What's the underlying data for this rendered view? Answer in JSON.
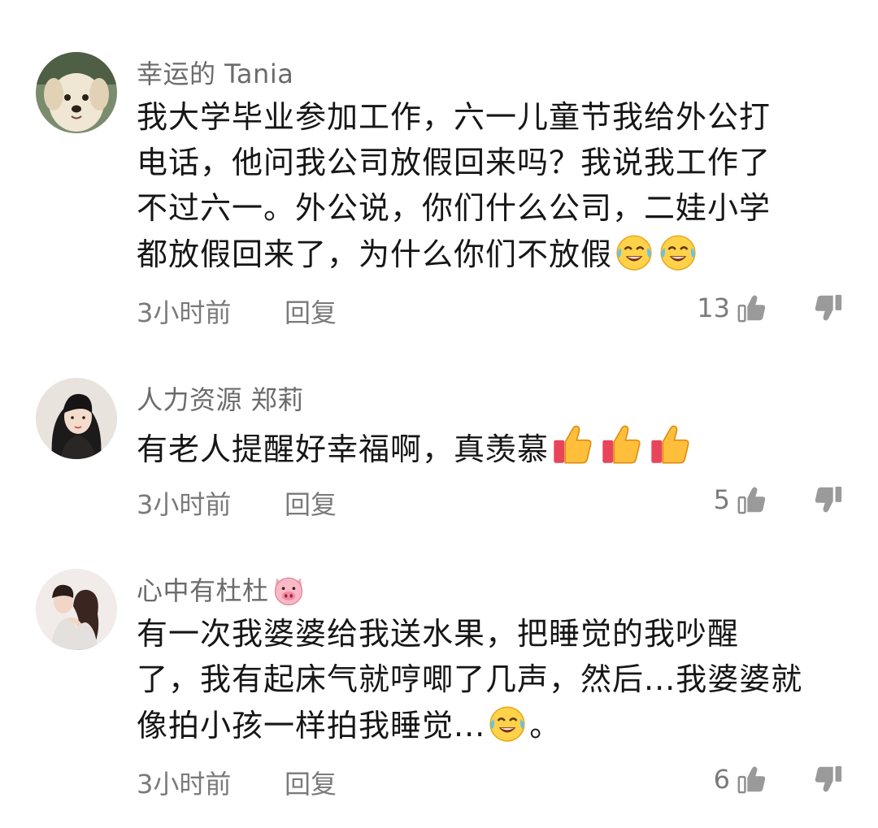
{
  "comments": [
    {
      "username": "幸运的 Tania",
      "text": [
        "我大学毕业参加工作，六一儿童节我给外公打",
        "电话，他问我公司放假回来吗？我说我工作了",
        "不过六一。外公说，你们什么公司，二娃小学",
        "都放假回来了，为什么你们不放假"
      ],
      "time": "3小时前",
      "reply_label": "回复",
      "likes": "13"
    },
    {
      "username": "人力资源 郑莉",
      "text": [
        "有老人提醒好幸福啊，真羡慕"
      ],
      "time": "3小时前",
      "reply_label": "回复",
      "likes": "5"
    },
    {
      "username": "心中有杜杜",
      "text": [
        "有一次我婆婆给我送水果，把睡觉的我吵醒",
        "了，我有起床气就哼唧了几声，然后...我婆婆就",
        "像拍小孩一样拍我睡觉...",
        "。"
      ],
      "time": "3小时前",
      "reply_label": "回复",
      "likes": "6"
    }
  ],
  "icons": {
    "like": "thumbs-up-icon",
    "dislike": "thumbs-down-icon",
    "emoji_cry_laugh": "tears-of-joy-emoji",
    "emoji_thumb": "thumbs-up-emoji",
    "emoji_pig": "pig-face-emoji"
  },
  "colors": {
    "username": "#6b6b6b",
    "meta": "#7a7a7a",
    "text": "#161616"
  }
}
